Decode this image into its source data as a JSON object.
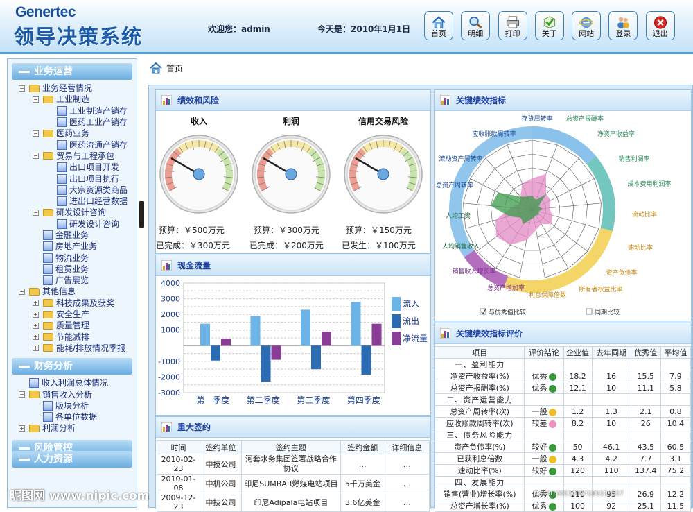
{
  "header": {
    "logo_en": "Genertec",
    "logo_cn": "领导决策系统",
    "welcome": "欢迎您：admin",
    "today": "今天是：2010年1月1日",
    "buttons": [
      {
        "label": "首页",
        "icon": "home-icon"
      },
      {
        "label": "明细",
        "icon": "magnifier-icon"
      },
      {
        "label": "打印",
        "icon": "printer-icon"
      },
      {
        "label": "关于",
        "icon": "checkmark-icon"
      },
      {
        "label": "网站",
        "icon": "ie-icon"
      },
      {
        "label": "登录",
        "icon": "users-icon"
      },
      {
        "label": "退出",
        "icon": "exit-icon"
      }
    ]
  },
  "sidebar": {
    "sections": [
      {
        "title": "业务运营",
        "items": [
          {
            "label": "业务经营情况",
            "type": "folder",
            "toggle": "−",
            "level": 0
          },
          {
            "label": "工业制造",
            "type": "folder",
            "toggle": "−",
            "level": 1
          },
          {
            "label": "工业制造产销存",
            "type": "doc",
            "level": 2
          },
          {
            "label": "医药工业产销存",
            "type": "doc",
            "level": 2
          },
          {
            "label": "医药业务",
            "type": "folder",
            "toggle": "−",
            "level": 1
          },
          {
            "label": "医药流通产销存",
            "type": "doc",
            "level": 2
          },
          {
            "label": "贸易与工程承包",
            "type": "folder",
            "toggle": "−",
            "level": 1
          },
          {
            "label": "出口项目开发",
            "type": "doc",
            "level": 2
          },
          {
            "label": "出口项目执行",
            "type": "doc",
            "level": 2
          },
          {
            "label": "大宗资源类商品",
            "type": "doc",
            "level": 2
          },
          {
            "label": "进出口经营数据",
            "type": "doc",
            "level": 2
          },
          {
            "label": "研发设计咨询",
            "type": "folder",
            "toggle": "−",
            "level": 1
          },
          {
            "label": "研发设计咨询",
            "type": "doc",
            "level": 2
          },
          {
            "label": "金融业务",
            "type": "doc",
            "level": 1
          },
          {
            "label": "房地产业务",
            "type": "doc",
            "level": 1
          },
          {
            "label": "物流业务",
            "type": "doc",
            "level": 1
          },
          {
            "label": "租赁业务",
            "type": "doc",
            "level": 1
          },
          {
            "label": "广告展览",
            "type": "doc",
            "level": 1
          },
          {
            "label": "其他信息",
            "type": "folder",
            "toggle": "−",
            "level": 0
          },
          {
            "label": "科技成果及获奖",
            "type": "folder",
            "toggle": "+",
            "level": 1
          },
          {
            "label": "安全生产",
            "type": "folder",
            "toggle": "+",
            "level": 1
          },
          {
            "label": "质量管理",
            "type": "folder",
            "toggle": "+",
            "level": 1
          },
          {
            "label": "节能减排",
            "type": "folder",
            "toggle": "+",
            "level": 1
          },
          {
            "label": "能耗/排放情况季报",
            "type": "folder",
            "toggle": "+",
            "level": 1
          }
        ]
      },
      {
        "title": "财务分析",
        "items": [
          {
            "label": "收入利润总体情况",
            "type": "doc",
            "level": 0
          },
          {
            "label": "销售收入分析",
            "type": "folder",
            "toggle": "−",
            "level": 0
          },
          {
            "label": "版块分析",
            "type": "doc",
            "level": 1
          },
          {
            "label": "各单位数据",
            "type": "doc",
            "level": 1
          },
          {
            "label": "利润分析",
            "type": "folder",
            "toggle": "+",
            "level": 0
          }
        ]
      },
      {
        "title": "风险管控",
        "items": []
      },
      {
        "title": "人力资源",
        "items": []
      }
    ]
  },
  "breadcrumb": "首页",
  "perf": {
    "title": "绩效和风险",
    "gauges": [
      {
        "title": "收入",
        "line1": "预算：￥500万元",
        "line2": "已完成：￥300万元",
        "value": 0.6
      },
      {
        "title": "利润",
        "line1": "预算：￥300万元",
        "line2": "已完成：￥200万元",
        "value": 0.667
      },
      {
        "title": "信用交易风险",
        "line1": "预算：￥150万元",
        "line2": "已发生：￥100万元",
        "value": 0.667
      }
    ]
  },
  "cashflow": {
    "title": "现金流量"
  },
  "chart_data": {
    "type": "bar",
    "categories": [
      "第一季度",
      "第二季度",
      "第三季度",
      "第四季度"
    ],
    "series": [
      {
        "name": "流入",
        "values": [
          1400,
          1900,
          2300,
          2800
        ],
        "color": "#6cb3e6"
      },
      {
        "name": "流出",
        "values": [
          -950,
          -2300,
          -1500,
          -1850
        ],
        "color": "#2b6cb3"
      },
      {
        "name": "净流量",
        "values": [
          450,
          -900,
          900,
          1400
        ],
        "color": "#8a3d97"
      }
    ],
    "ylim": [
      -3000,
      4000
    ],
    "yticks": [
      4000,
      3000,
      2000,
      1000,
      -1000,
      -2000,
      -3000
    ],
    "legend": "right"
  },
  "signing": {
    "title": "重大签约",
    "headers": [
      "时间",
      "签约单位",
      "签约主题",
      "签约金额",
      "详细信息"
    ],
    "rows": [
      [
        "2010-02-23",
        "中技公司",
        "河套水务集团签署战略合作协议",
        "…",
        "…"
      ],
      [
        "2010-01-08",
        "中机公司",
        "印尼SUMBAR燃煤电站项目",
        "5千万美金",
        "…"
      ],
      [
        "2009-12-23",
        "中技公司",
        "印尼Adipala电站项目",
        "3.6亿美金",
        "…"
      ]
    ]
  },
  "radar": {
    "title": "关键绩效指标",
    "labels": [
      "存货周转率",
      "总资产报酬率",
      "净资产收益率",
      "销售利润率",
      "成本费用利润率",
      "流动比率",
      "速动比率",
      "资产负债率",
      "所有者权益比率",
      "利息保障倍数",
      "总资产增加率",
      "销售收入增长率",
      "人均销售收入",
      "人均工资",
      "总资产周转率",
      "流动资产周转率",
      "应收账款周转率"
    ],
    "ring_colors": [
      "#63aee6",
      "#3fa9a3",
      "#e8c33a",
      "#e8c33a",
      "#a04aa8",
      "#63aee6"
    ],
    "check1": "与优秀值比较",
    "check2": "同期比较"
  },
  "kpi": {
    "title": "关键绩效指标评价",
    "headers": [
      "项目",
      "评价结论",
      "企业值",
      "去年同期",
      "优秀值",
      "平均值"
    ],
    "rows": [
      {
        "cat": "一、盈利能力"
      },
      {
        "name": "净资产收益率(%)",
        "eval": "优秀",
        "dot": "green",
        "v": [
          "18.2",
          "16",
          "15.5",
          "7.9"
        ]
      },
      {
        "name": "总资产报酬率(%)",
        "eval": "优秀",
        "dot": "green",
        "v": [
          "12.1",
          "10",
          "11.1",
          "5.8"
        ]
      },
      {
        "cat": "二、资产运营能力"
      },
      {
        "name": "总资产周转率(次)",
        "eval": "一般",
        "dot": "yellow",
        "v": [
          "1.2",
          "1.3",
          "2.1",
          "0.8"
        ]
      },
      {
        "name": "应收账款周转率(次)",
        "eval": "较差",
        "dot": "pink",
        "v": [
          "8.2",
          "10",
          "26",
          "10.4"
        ]
      },
      {
        "cat": "三、债务风险能力"
      },
      {
        "name": "资产负债率(%)",
        "eval": "较好",
        "dot": "green",
        "v": [
          "50",
          "46.1",
          "43.5",
          "60.5"
        ]
      },
      {
        "name": "已获利息倍数",
        "eval": "一般",
        "dot": "yellow",
        "v": [
          "4.3",
          "4.2",
          "7.7",
          "3.1"
        ]
      },
      {
        "name": "速动比率(%)",
        "eval": "较好",
        "dot": "green",
        "v": [
          "120",
          "110",
          "137.4",
          "75.2"
        ]
      },
      {
        "cat": "四、发展能力"
      },
      {
        "name": "销售(营业)增长率(%)",
        "eval": "优秀",
        "dot": "green",
        "v": [
          "110",
          "95",
          "26.9",
          "12.2"
        ]
      },
      {
        "name": "总资产增长率(%)",
        "eval": "优秀",
        "dot": "green",
        "v": [
          "100",
          "92",
          "25.1",
          "11.5"
        ]
      }
    ]
  },
  "watermark": {
    "text": "昵图网 www.nipic.com",
    "id": "No:20100510094183105557"
  }
}
